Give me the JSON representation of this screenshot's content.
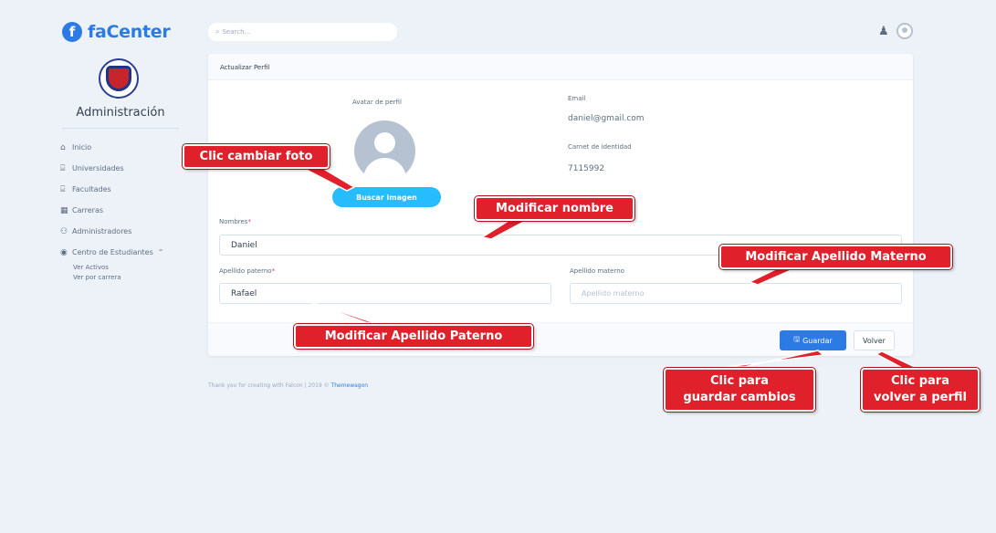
{
  "brand": {
    "logo_letter": "f",
    "name": "faCenter"
  },
  "sidebar": {
    "role_title": "Administración",
    "items": [
      {
        "icon": "home-icon",
        "glyph": "⌂",
        "label": "Inicio"
      },
      {
        "icon": "university-icon",
        "glyph": "⌸",
        "label": "Universidades"
      },
      {
        "icon": "faculty-icon",
        "glyph": "⌸",
        "label": "Facultades"
      },
      {
        "icon": "building-icon",
        "glyph": "▦",
        "label": "Carreras"
      },
      {
        "icon": "users-icon",
        "glyph": "⚇",
        "label": "Administradores"
      },
      {
        "icon": "student-center-icon",
        "glyph": "◉",
        "label": "Centro de Estudiantes",
        "chevron": "⌃"
      }
    ],
    "subitems": [
      "Ver Activos",
      "Ver por carrera"
    ]
  },
  "topbar": {
    "search_placeholder": "Search...",
    "search_icon": "⌕",
    "bell_icon": "♟"
  },
  "card": {
    "title": "Actualizar Perfil",
    "avatar_label": "Avatar de perfil",
    "photo_button": "Buscar imagen",
    "email_label": "Email",
    "email_value": "daniel@gmail.com",
    "ci_label": "Carnet de identidad",
    "ci_value": "7115992",
    "nombres_label": "Nombres",
    "nombres_value": "Daniel",
    "paterno_label": "Apellido paterno",
    "paterno_value": "Rafael",
    "materno_label": "Apellido materno",
    "materno_placeholder": "Apellido materno",
    "required_mark": "*",
    "save_button": "Guardar",
    "save_icon": "🖫",
    "back_button": "Volver"
  },
  "footer": {
    "text": "Thank you for creating with Falcon | 2019 © ",
    "link": "Themewagon"
  },
  "callouts": {
    "change_photo": "Clic cambiar foto",
    "edit_name": "Modificar nombre",
    "edit_maternal": "Modificar Apellido Materno",
    "edit_paternal": "Modificar Apellido Paterno",
    "save_line1": "Clic para",
    "save_line2": "guardar cambios",
    "back_line1": "Clic para",
    "back_line2": "volver a perfil"
  },
  "colors": {
    "primary": "#2c7be5",
    "info": "#27bcfd",
    "callout": "#e0202a",
    "background": "#edf2f9"
  }
}
